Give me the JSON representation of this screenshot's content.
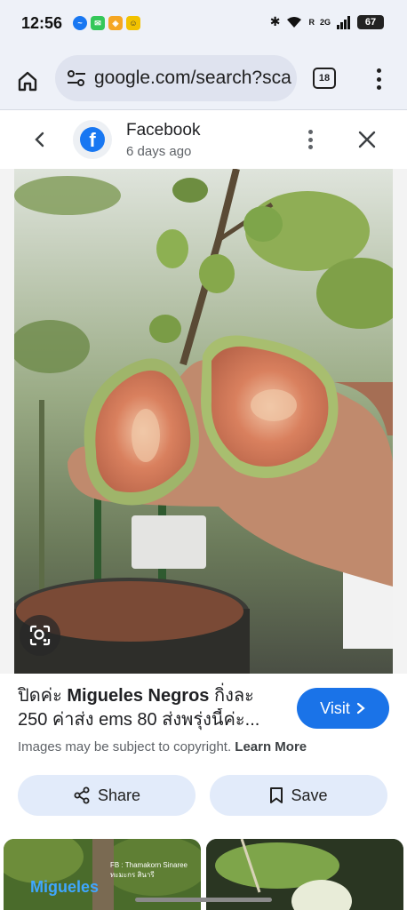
{
  "status_bar": {
    "time": "12:56",
    "network": "2G",
    "roaming": "R",
    "battery": "67"
  },
  "browser": {
    "url": "google.com/search?sca",
    "tab_count": "18"
  },
  "source": {
    "name": "Facebook",
    "time_ago": "6 days ago"
  },
  "result": {
    "title_part1": "ปิดค่ะ ",
    "title_bold": "Migueles Negros",
    "title_part2": " กิ่งละ",
    "title_line2": "250 ค่าส่ง ems 80 ส่งพรุ่งนี้ค่ะ...",
    "visit_label": "Visit",
    "copyright_text": "Images may be subject to copyright.",
    "learn_more": "Learn More",
    "share_label": "Share",
    "save_label": "Save"
  },
  "thumbnails": [
    {
      "label": "Migueles",
      "sub_line1": "FB : Thamakorn Sinaree",
      "sub_line2": "ทะมะกร สินารี"
    },
    {
      "label": ""
    }
  ],
  "colors": {
    "accent": "#1a73e8",
    "facebook": "#1877f2",
    "button_bg": "#e2ebfa",
    "toolbar_bg": "#eef1f8"
  }
}
